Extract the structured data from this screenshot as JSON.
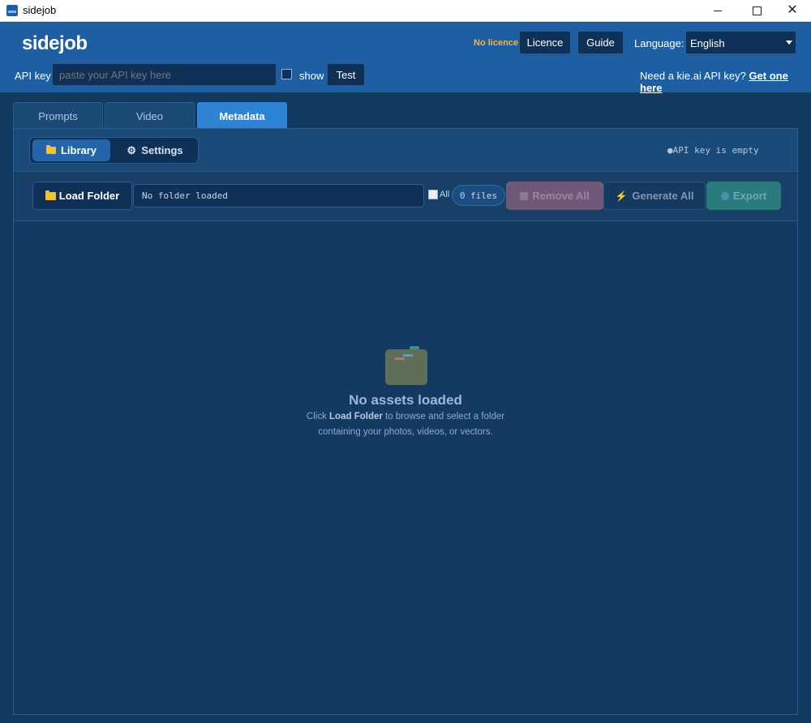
{
  "window": {
    "title": "sidejob"
  },
  "header": {
    "logo": "sidejob",
    "licence_status": "No licence",
    "licence_button": "Licence",
    "guide_button": "Guide",
    "language_label": "Language:",
    "language_value": "English",
    "api_key_label": "API key:",
    "api_key_placeholder": "paste your API key here",
    "show_label": "show",
    "test_button": "Test",
    "need_key_text": "Need a kie.ai API key?",
    "get_one_link": "Get one here"
  },
  "tabs": [
    {
      "label": "Prompts",
      "active": false
    },
    {
      "label": "Video",
      "active": false
    },
    {
      "label": "Metadata",
      "active": true
    }
  ],
  "subtabs": {
    "library": "Library",
    "settings": "Settings"
  },
  "api_status": "●API key is empty",
  "toolbar": {
    "load_folder": "Load Folder",
    "folder_path": "No folder loaded",
    "all_label": "All",
    "files_count": "0 files",
    "remove_all": "Remove All",
    "generate_all": "Generate All",
    "export": "Export"
  },
  "empty_state": {
    "title": "No assets loaded",
    "line1_pre": "Click ",
    "line1_bold": "Load Folder",
    "line1_post": " to browse and select a folder",
    "line2": "containing your photos, videos, or vectors."
  }
}
